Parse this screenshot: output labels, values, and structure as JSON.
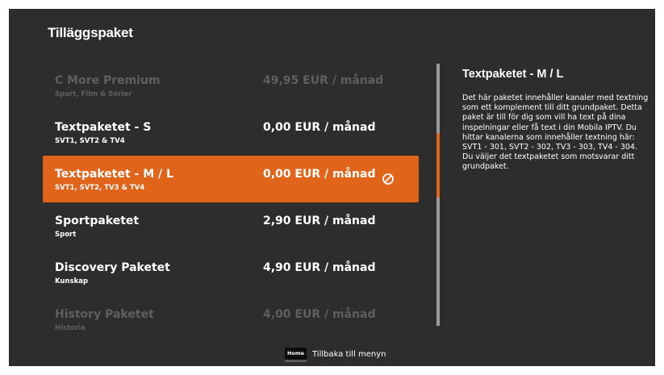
{
  "header": {
    "title": "Tilläggspaket"
  },
  "packages": [
    {
      "name": "C More Premium",
      "subtitle": "Sport, Film & Serier",
      "price": "49,95 EUR /  månad",
      "state": "dim"
    },
    {
      "name": "Textpaketet - S",
      "subtitle": "SVT1, SVT2 & TV4",
      "price": "0,00 EUR /  månad",
      "state": "normal"
    },
    {
      "name": "Textpaketet - M / L",
      "subtitle": "SVT1, SVT2, TV3 & TV4",
      "price": "0,00 EUR /  månad",
      "state": "selected",
      "status_icon": "blocked-icon"
    },
    {
      "name": "Sportpaketet",
      "subtitle": "Sport",
      "price": "2,90 EUR /  månad",
      "state": "normal"
    },
    {
      "name": "Discovery Paketet",
      "subtitle": "Kunskap",
      "price": "4,90 EUR /  månad",
      "state": "normal"
    },
    {
      "name": "History Paketet",
      "subtitle": "Historia",
      "price": "4,00 EUR /  månad",
      "state": "dim"
    }
  ],
  "detail": {
    "title": "Textpaketet - M / L",
    "description": "Det här paketet innehåller kanaler med textning som ett komplement till ditt grundpaket. Detta paket är till för dig som vill ha text på dina inspelningar eller få text i din Mobila IPTV. Du hittar kanalerna som innehåller textning här: SVT1 - 301, SVT2 - 302, TV3 - 303, TV4 - 304. Du väljer det textpaketet som motsvarar ditt grundpaket."
  },
  "footer": {
    "key_label": "Home",
    "action_label": "Tillbaka till menyn"
  },
  "colors": {
    "background": "#2d2d2d",
    "accent": "#e0641a",
    "dim_text": "#5f5f5f",
    "text": "#ffffff"
  }
}
